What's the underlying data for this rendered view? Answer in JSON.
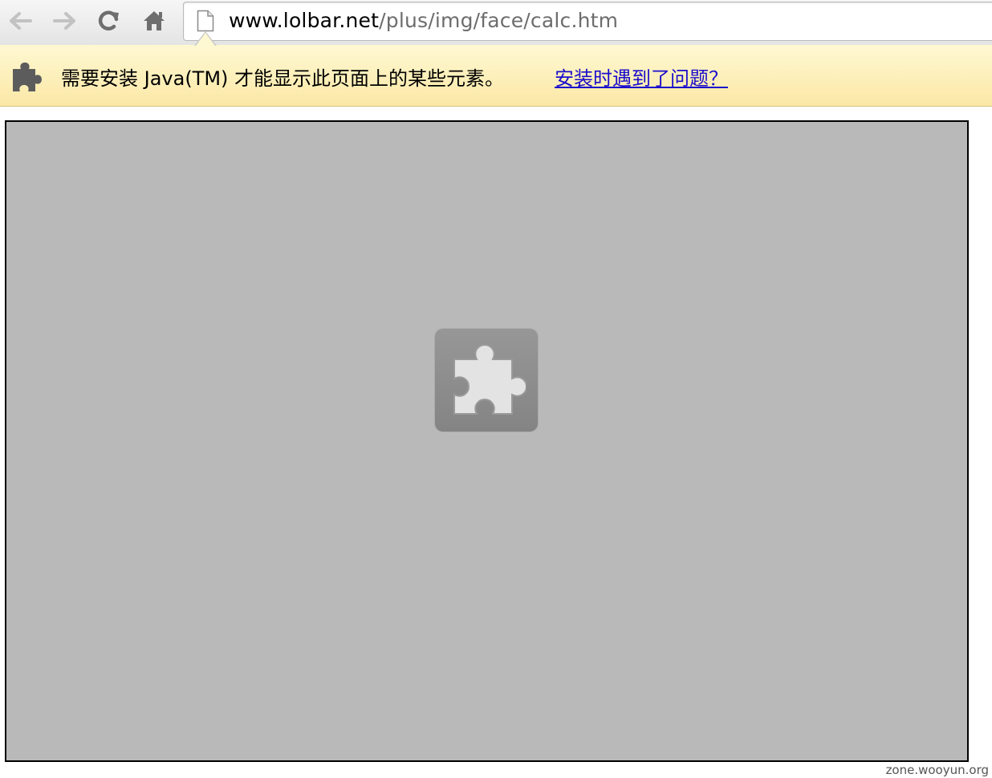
{
  "toolbar": {
    "back_icon": "back-arrow-icon",
    "forward_icon": "forward-arrow-icon",
    "reload_icon": "reload-icon",
    "home_icon": "home-icon"
  },
  "omnibox": {
    "page_icon": "page-document-icon",
    "url_host": "www.lolbar.net",
    "url_path": "/plus/img/face/calc.htm"
  },
  "infobar": {
    "icon": "puzzle-plugin-icon",
    "message": "需要安装 Java(TM) 才能显示此页面上的某些元素。",
    "link": "安装时遇到了问题？"
  },
  "content": {
    "placeholder_icon": "missing-plugin-puzzle-icon"
  },
  "watermark": "zone.wooyun.org",
  "colors": {
    "infobar_bg": "#fdf1bd",
    "link": "#1a0dcc",
    "plugin_area": "#b9b9b9"
  }
}
